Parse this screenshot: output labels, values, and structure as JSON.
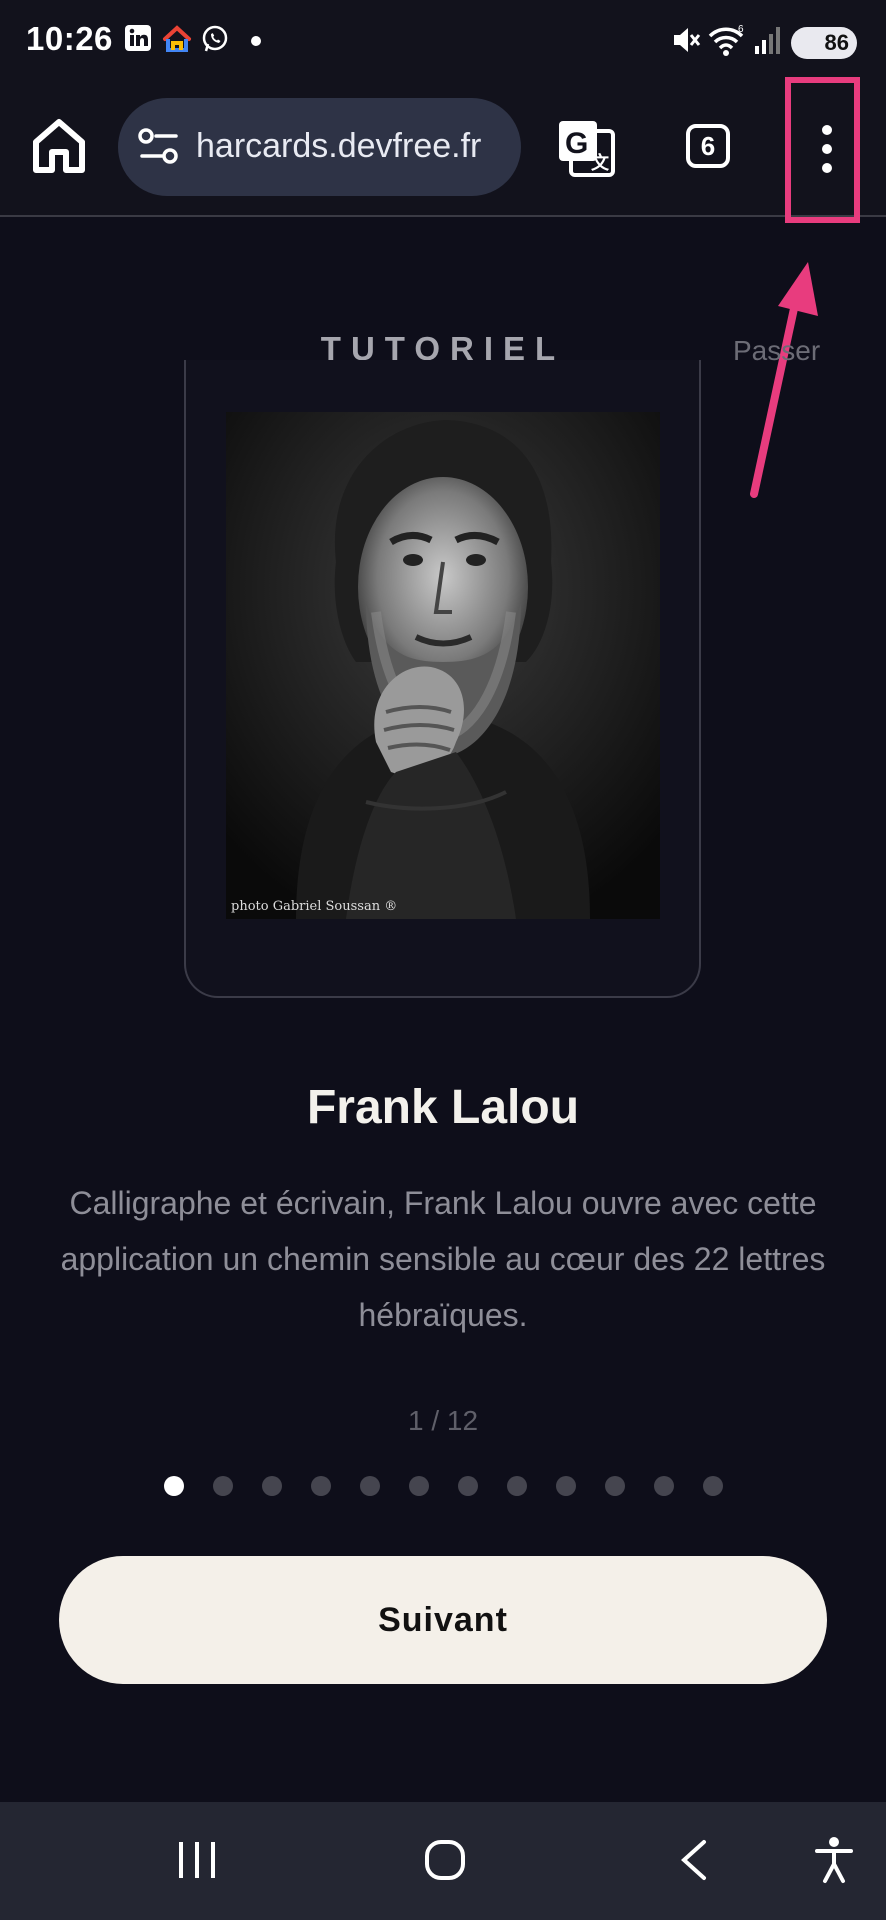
{
  "status_bar": {
    "time": "10:26",
    "battery": "86",
    "icons": [
      "linkedin-icon",
      "google-home-icon",
      "whatsapp-icon",
      "dot-icon",
      "mute-icon",
      "wifi-icon",
      "signal-icon",
      "battery-icon"
    ]
  },
  "browser": {
    "url": "harcards.devfree.fr",
    "tab_count": "6",
    "icons": [
      "home-icon",
      "site-settings-icon",
      "translate-icon",
      "tabs-icon",
      "more-vert-icon"
    ],
    "highlight_color": "#e83c7e"
  },
  "page": {
    "title": "TUTORIEL",
    "skip_label": "Passer",
    "photo_credit": "photo Gabriel Soussan ®",
    "person_name": "Frank Lalou",
    "description": "Calligraphe et écrivain, Frank Lalou ouvre avec cette application un chemin sensible au cœur des 22 lettres hébraïques.",
    "pager": "1 / 12",
    "current_step": 1,
    "total_steps": 12,
    "next_label": "Suivant",
    "colors": {
      "background": "#0e0e1a",
      "button": "#f4f0e9"
    }
  },
  "nav_bar": {
    "icons": [
      "recent-apps-icon",
      "home-circle-icon",
      "back-icon",
      "accessibility-icon"
    ]
  }
}
